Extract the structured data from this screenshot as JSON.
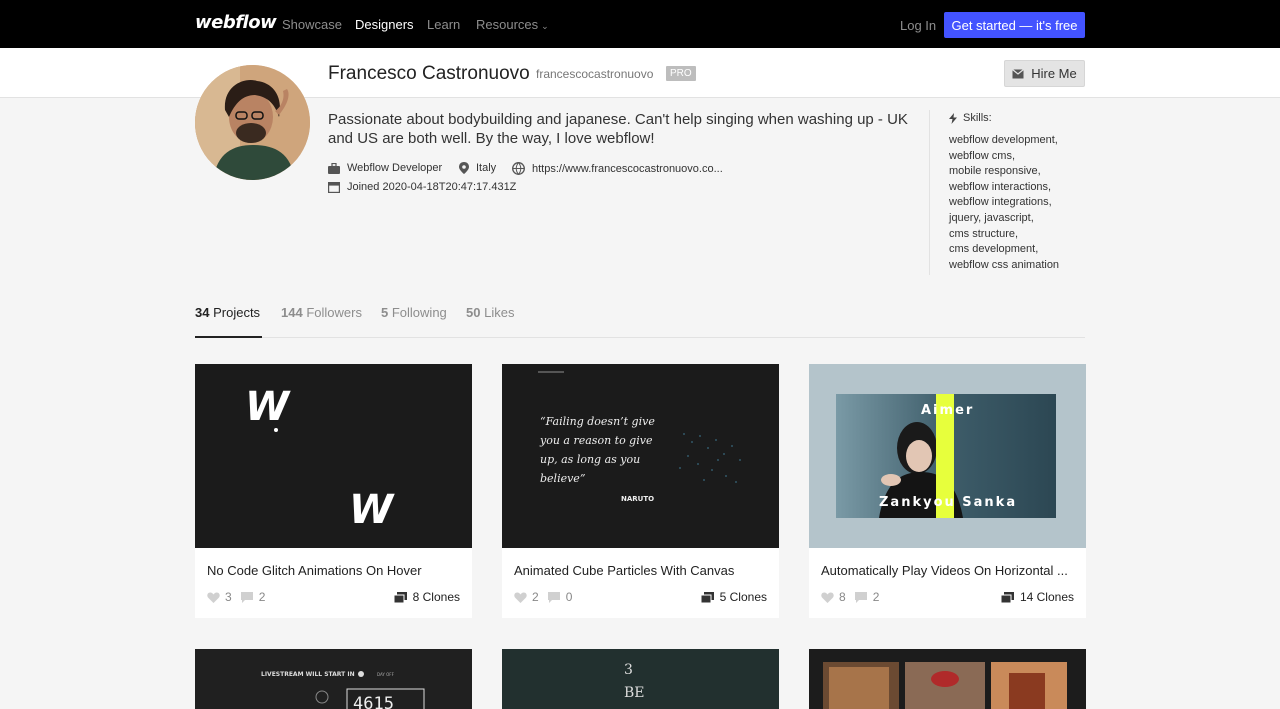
{
  "nav": {
    "logo": "webflow",
    "links": [
      "Showcase",
      "Designers",
      "Learn",
      "Resources"
    ],
    "login": "Log In",
    "cta": "Get started — it's free"
  },
  "profile": {
    "name": "Francesco Castronuovo",
    "handle": "francescocastronuovo",
    "badge": "PRO",
    "hire": "Hire Me",
    "bio": "Passionate about bodybuilding and japanese. Can't help singing when washing up - UK and US are both well. By the way, I love webflow!",
    "role": "Webflow Developer",
    "location": "Italy",
    "website": "https://www.francescocastronuovo.co...",
    "joined": "Joined 2020-04-18T20:47:17.431Z"
  },
  "skills": {
    "heading": "Skills:",
    "items": [
      "webflow development,",
      "webflow cms,",
      "mobile responsive,",
      "webflow interactions,",
      "webflow integrations,",
      "jquery,",
      "javascript,",
      "cms structure,",
      "cms development,",
      "webflow css animation"
    ]
  },
  "tabs": [
    {
      "count": "34",
      "label": "Projects"
    },
    {
      "count": "144",
      "label": "Followers"
    },
    {
      "count": "5",
      "label": "Following"
    },
    {
      "count": "50",
      "label": "Likes"
    }
  ],
  "cards": [
    {
      "title": "No Code Glitch Animations On Hover",
      "likes": "3",
      "comments": "2",
      "clones": "8 Clones"
    },
    {
      "title": "Animated Cube Particles With Canvas",
      "likes": "2",
      "comments": "0",
      "clones": "5 Clones"
    },
    {
      "title": "Automatically Play Videos On Horizontal ...",
      "likes": "8",
      "comments": "2",
      "clones": "14 Clones"
    }
  ],
  "thumbs": {
    "card1_letter": "W",
    "card2_quote": [
      "“Failing doesn’t give",
      "you a reason to give",
      "up, as long as you",
      "believe”"
    ],
    "card2_sign": "NARUTO",
    "card3_top": "Aimer",
    "card3_bottom": "Zankyou Sanka",
    "row2_card1_text": "LIVESTREAM WILL START IN",
    "row2_card1_sub": "DAY OFF",
    "row2_card1_num": "4615",
    "row2_card2_text": "3",
    "row2_card2_sub": "BE"
  },
  "colors": {
    "accent": "#4353ff",
    "nav_bg": "#000000",
    "badge": "#bdbdbd"
  }
}
